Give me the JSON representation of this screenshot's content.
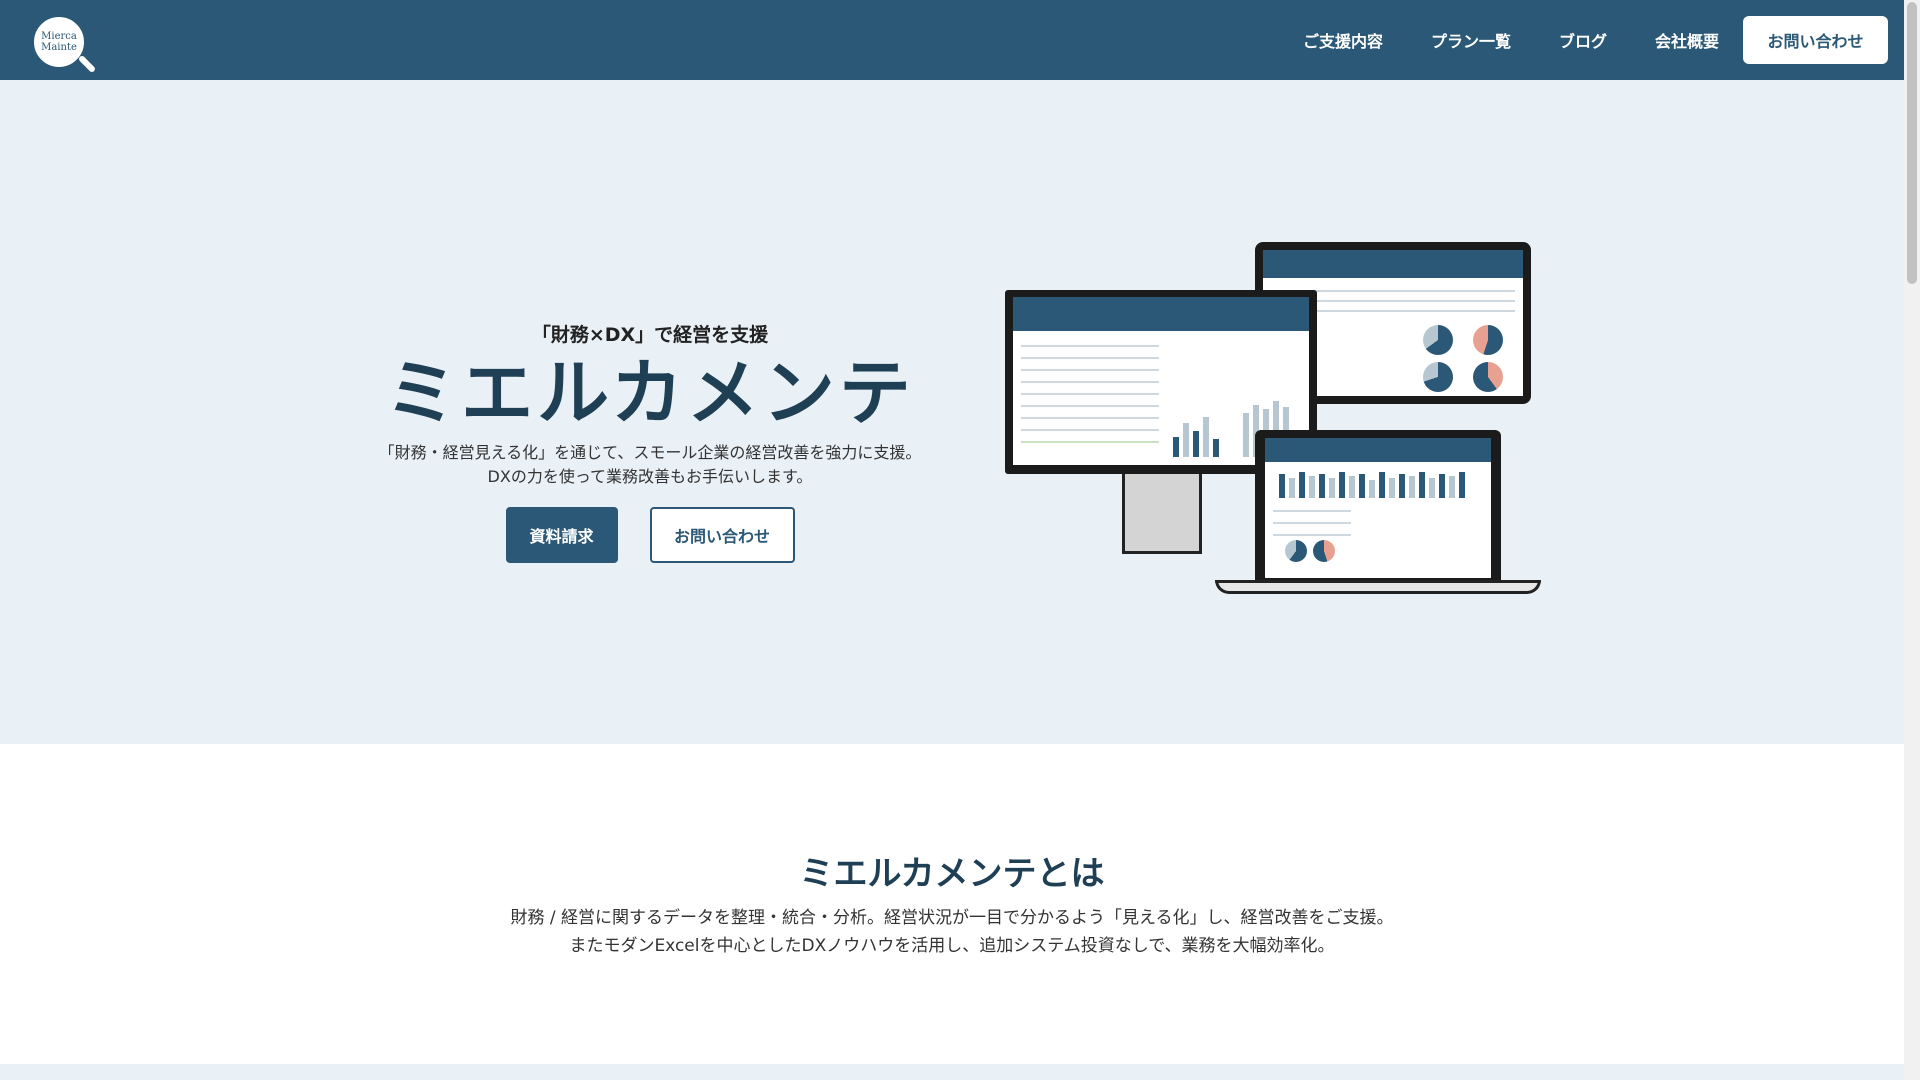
{
  "header": {
    "logo_line1": "Mierca",
    "logo_line2": "Mainte",
    "nav": [
      {
        "label": "ご支援内容"
      },
      {
        "label": "プラン一覧"
      },
      {
        "label": "ブログ"
      },
      {
        "label": "会社概要"
      }
    ],
    "cta_label": "お問い合わせ"
  },
  "hero": {
    "tagline": "「財務×DX」で経営を支援",
    "title": "ミエルカメンテ",
    "desc_line1": "「財務・経営見える化」を通じて、スモール企業の経営改善を強力に支援。",
    "desc_line2": "DXの力を使って業務改善もお手伝いします。",
    "primary_button": "資料請求",
    "secondary_button": "お問い合わせ"
  },
  "about": {
    "title": "ミエルカメンテとは",
    "desc_line1": "財務 / 経営に関するデータを整理・統合・分析。経営状況が一目で分かるよう「見える化」し、経営改善をご支援。",
    "desc_line2": "またモダンExcelを中心としたDXノウハウを活用し、追加システム投資なしで、業務を大幅効率化。"
  },
  "colors": {
    "brand": "#2b5876",
    "hero_bg": "#e9f0f6"
  }
}
